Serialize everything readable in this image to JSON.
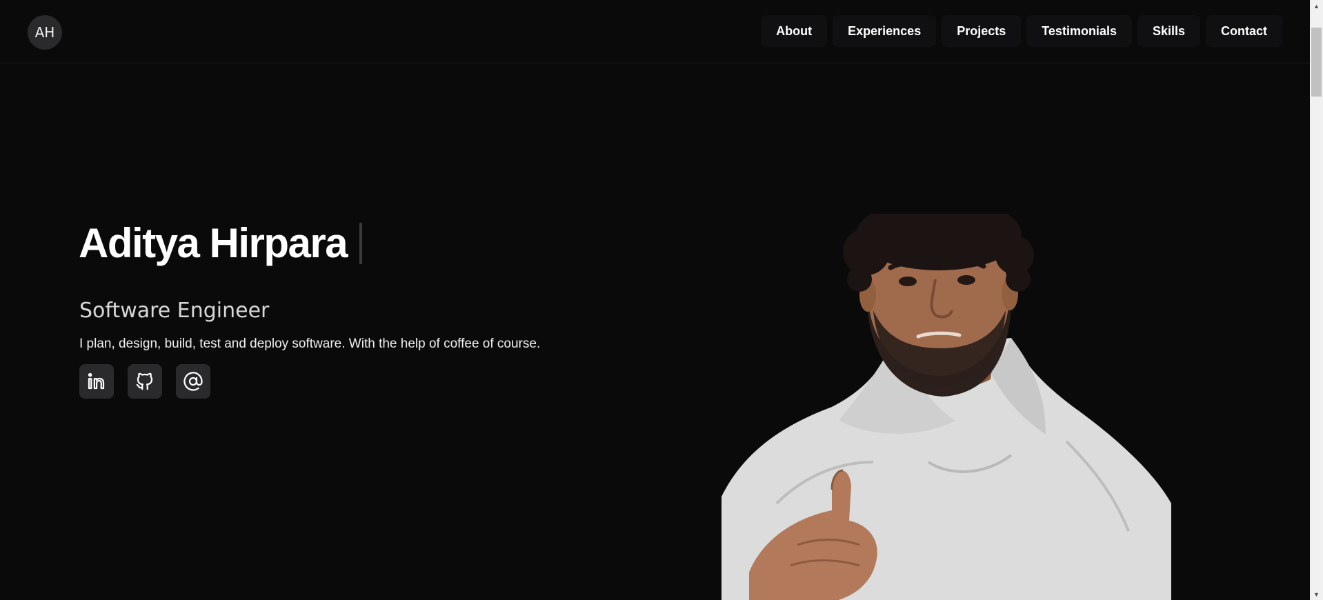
{
  "header": {
    "logo_text": "AH",
    "nav": [
      {
        "label": "About"
      },
      {
        "label": "Experiences"
      },
      {
        "label": "Projects"
      },
      {
        "label": "Testimonials"
      },
      {
        "label": "Skills"
      },
      {
        "label": "Contact"
      }
    ]
  },
  "hero": {
    "name": "Aditya Hirpara",
    "title": "Software Engineer",
    "description": "I plan, design, build, test and deploy software. With the help of coffee of course.",
    "socials": [
      {
        "icon": "linkedin-icon"
      },
      {
        "icon": "github-icon"
      },
      {
        "icon": "at-sign-icon"
      }
    ]
  },
  "colors": {
    "background": "#0a0a0b",
    "nav_item_bg": "#101012",
    "icon_button_bg": "#2a2a2d",
    "text_primary": "#ffffff",
    "text_secondary": "#d8d8d8"
  }
}
